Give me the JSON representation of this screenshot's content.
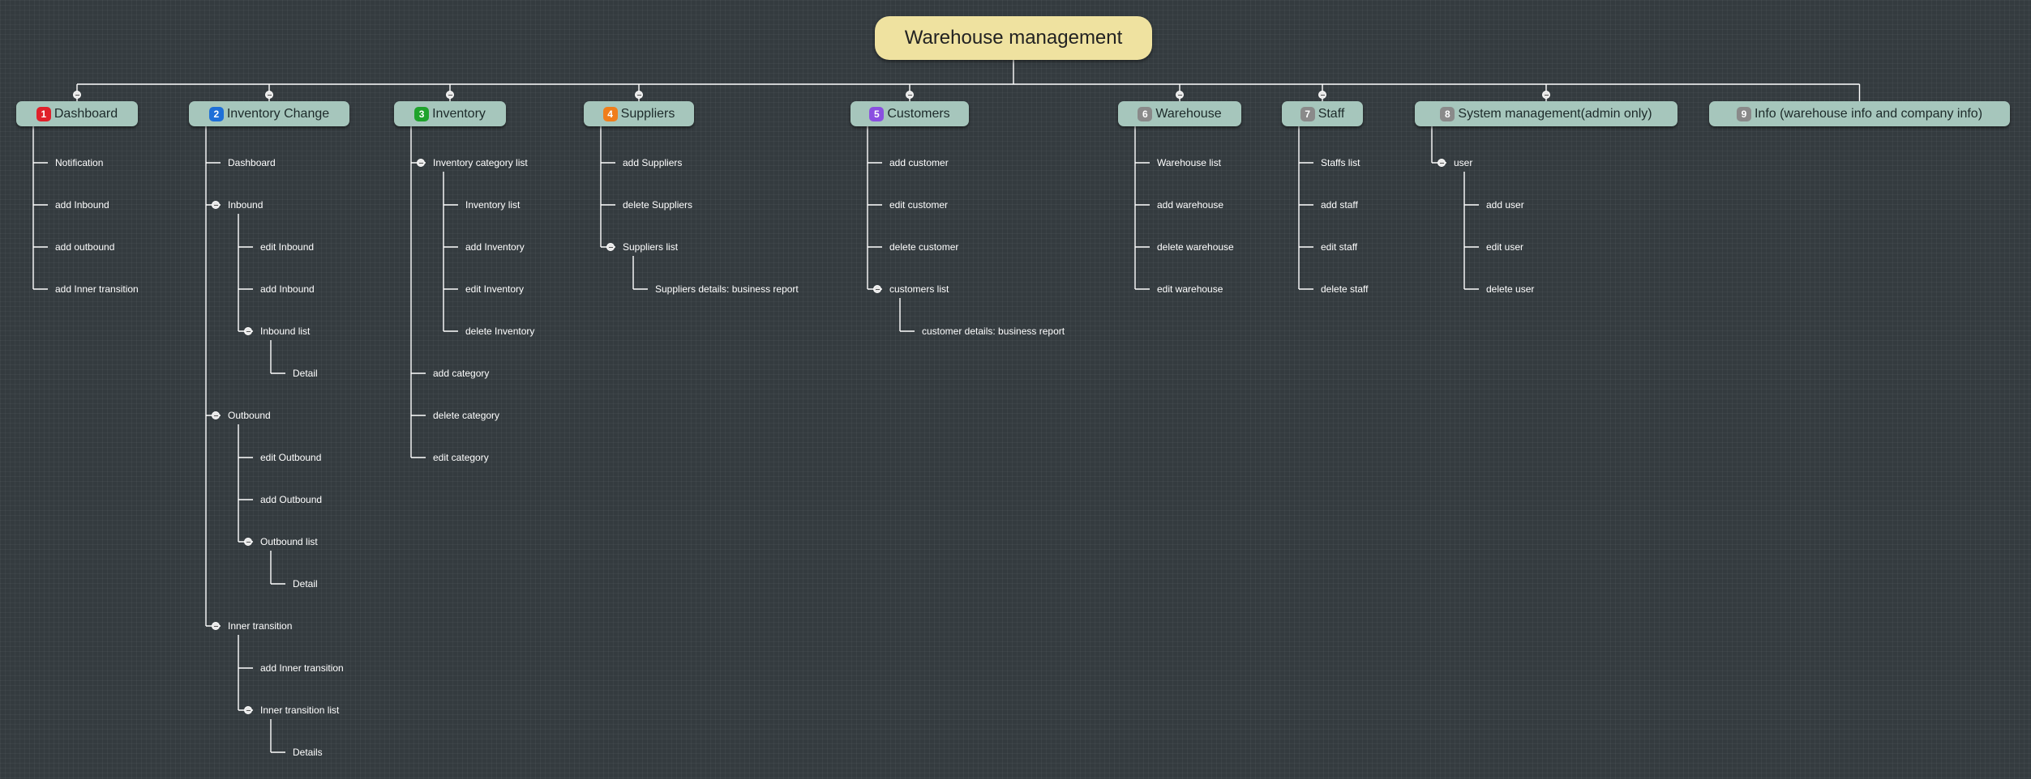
{
  "root": {
    "label": "Warehouse management"
  },
  "colors": {
    "line": "#ffffff",
    "branch_bg": "#a6c6bc",
    "root_bg": "#efe2a0",
    "background": "#343b3f"
  },
  "branches": [
    {
      "num": "1",
      "label": "Dashboard",
      "badge_color": "#e0202a",
      "items": [
        {
          "label": "Notification"
        },
        {
          "label": "add Inbound"
        },
        {
          "label": "add outbound"
        },
        {
          "label": "add Inner transition"
        }
      ]
    },
    {
      "num": "2",
      "label": "Inventory Change",
      "badge_color": "#1e6fd8",
      "items": [
        {
          "label": "Dashboard"
        },
        {
          "label": "Inbound",
          "children": [
            {
              "label": "edit Inbound"
            },
            {
              "label": "add Inbound"
            },
            {
              "label": "Inbound list",
              "children": [
                {
                  "label": "Detail"
                }
              ]
            }
          ]
        },
        {
          "label": "Outbound",
          "children": [
            {
              "label": "edit Outbound"
            },
            {
              "label": "add Outbound"
            },
            {
              "label": "Outbound list",
              "children": [
                {
                  "label": "Detail"
                }
              ]
            }
          ]
        },
        {
          "label": "Inner transition",
          "children": [
            {
              "label": "add Inner transition"
            },
            {
              "label": "Inner transition list",
              "children": [
                {
                  "label": "Details"
                }
              ]
            }
          ]
        }
      ]
    },
    {
      "num": "3",
      "label": "Inventory",
      "badge_color": "#1fa32c",
      "items": [
        {
          "label": "Inventory category list",
          "children": [
            {
              "label": "Inventory list"
            },
            {
              "label": "add Inventory"
            },
            {
              "label": "edit Inventory"
            },
            {
              "label": "delete Inventory"
            }
          ]
        },
        {
          "label": "add category"
        },
        {
          "label": "delete category"
        },
        {
          "label": "edit category"
        }
      ]
    },
    {
      "num": "4",
      "label": "Suppliers",
      "badge_color": "#f07d1a",
      "items": [
        {
          "label": "add Suppliers"
        },
        {
          "label": "delete Suppliers"
        },
        {
          "label": "Suppliers list",
          "children": [
            {
              "label": "Suppliers details: business report"
            }
          ]
        }
      ]
    },
    {
      "num": "5",
      "label": "Customers",
      "badge_color": "#8a4fe0",
      "items": [
        {
          "label": "add customer"
        },
        {
          "label": "edit customer"
        },
        {
          "label": "delete customer"
        },
        {
          "label": "customers list",
          "children": [
            {
              "label": "customer details: business report"
            }
          ]
        }
      ]
    },
    {
      "num": "6",
      "label": "Warehouse",
      "badge_color": "#8a8a8a",
      "items": [
        {
          "label": "Warehouse list"
        },
        {
          "label": "add warehouse"
        },
        {
          "label": "delete warehouse"
        },
        {
          "label": "edit warehouse"
        }
      ]
    },
    {
      "num": "7",
      "label": "Staff",
      "badge_color": "#8a8a8a",
      "items": [
        {
          "label": "Staffs list"
        },
        {
          "label": "add staff"
        },
        {
          "label": "edit staff"
        },
        {
          "label": "delete staff"
        }
      ]
    },
    {
      "num": "8",
      "label": "System management(admin only)",
      "badge_color": "#8a8a8a",
      "items": [
        {
          "label": "user",
          "children": [
            {
              "label": "add user"
            },
            {
              "label": "edit user"
            },
            {
              "label": "delete user"
            }
          ]
        }
      ]
    },
    {
      "num": "9",
      "label": "Info (warehouse info and company info)",
      "badge_color": "#8a8a8a",
      "items": []
    }
  ]
}
